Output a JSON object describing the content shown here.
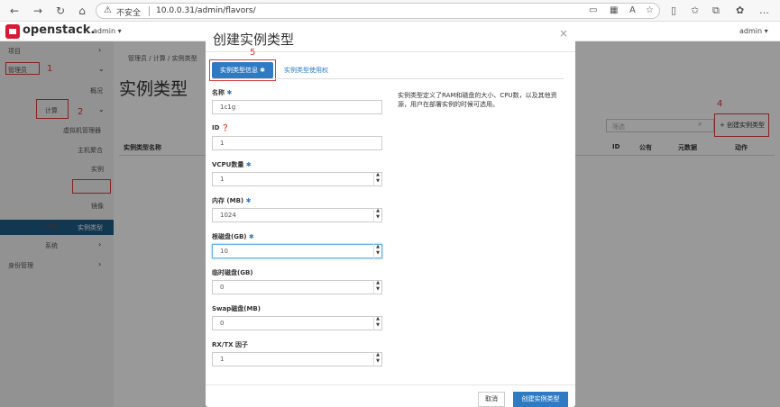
{
  "browser": {
    "insecure_label": "不安全",
    "url": "10.0.0.31/admin/flavors/"
  },
  "header": {
    "brand": "openstack.",
    "project_menu": "admin ▾",
    "user_menu": "admin ▾"
  },
  "sidebar": {
    "project": "项目",
    "admin": "管理员",
    "overview": "概况",
    "compute": "计算",
    "hypervisors": "虚拟机管理器",
    "host_aggregates": "主机聚合",
    "instances": "实例",
    "flavors": "实例类型",
    "images": "镜像",
    "network": "网络",
    "system": "系统",
    "identity": "身份管理"
  },
  "main": {
    "breadcrumb": "管理员 / 计算 / 实例类型",
    "title": "实例类型",
    "filter_placeholder": "筛选",
    "create_button": "+ 创建实例类型",
    "columns": [
      "实例类型名称",
      "ID",
      "公有",
      "元数据",
      "动作"
    ]
  },
  "annotations": [
    "1",
    "2",
    "3",
    "4",
    "5"
  ],
  "modal": {
    "title": "创建实例类型",
    "close": "×",
    "tab_info": "实例类型信息 ✱",
    "tab_access": "实例类型使用权",
    "help": "实例类型定义了RAM和磁盘的大小、CPU数，以及其他资源，用户在部署实例的时候可选用。",
    "fields": [
      {
        "label": "名称",
        "required": "✱",
        "value": "1c1g"
      },
      {
        "label": "ID ❓",
        "required": "",
        "value": "1"
      },
      {
        "label": "VCPU数量",
        "required": "✱",
        "value": "1"
      },
      {
        "label": "内存 (MB)",
        "required": "✱",
        "value": "1024"
      },
      {
        "label": "根磁盘(GB)",
        "required": "✱",
        "value": "10"
      },
      {
        "label": "临时磁盘(GB)",
        "required": "",
        "value": "0"
      },
      {
        "label": "Swap磁盘(MB)",
        "required": "",
        "value": "0"
      },
      {
        "label": "RX/TX 因子",
        "required": "",
        "value": "1"
      }
    ],
    "cancel": "取消",
    "submit": "创建实例类型"
  },
  "colors": {
    "accent": "#2e7bc4",
    "sidebar_active": "#1f5c87",
    "annotation": "#e03a3a",
    "brand_red": "#da1a32"
  }
}
